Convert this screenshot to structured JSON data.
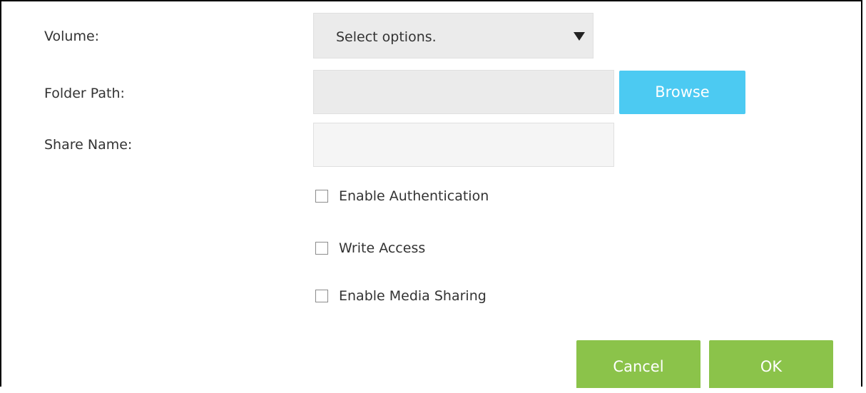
{
  "form": {
    "volume": {
      "label": "Volume:",
      "selected": "Select options."
    },
    "folder_path": {
      "label": "Folder Path:",
      "value": "",
      "browse_label": "Browse"
    },
    "share_name": {
      "label": "Share Name:",
      "value": ""
    },
    "checkboxes": [
      {
        "label": "Enable Authentication",
        "checked": false
      },
      {
        "label": "Write Access",
        "checked": false
      },
      {
        "label": "Enable Media Sharing",
        "checked": false
      }
    ]
  },
  "actions": {
    "cancel_label": "Cancel",
    "ok_label": "OK"
  },
  "colors": {
    "browse_button": "#4ccaf2",
    "action_button": "#8bc34a",
    "field_background": "#ebebeb"
  }
}
